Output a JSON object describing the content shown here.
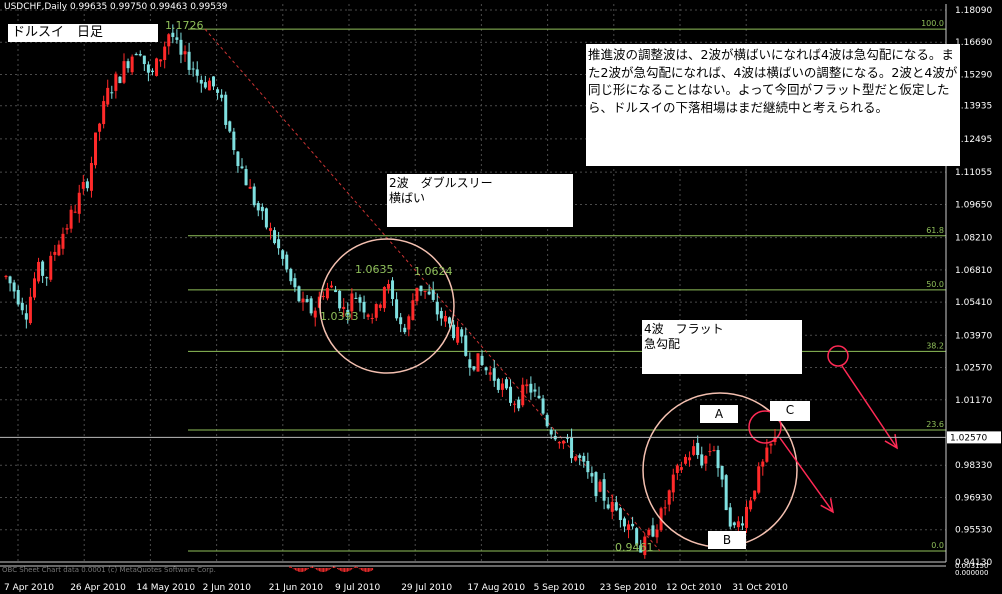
{
  "header": {
    "symbol_info": "USDCHF,Daily  0.99635 0.99750 0.99463 0.99539"
  },
  "title_box": {
    "text": "ドルスイ　日足"
  },
  "annotations": {
    "main_note": "推進波の調整波は、2波が横ばいになれば4波は急勾配になる。また2波が急勾配になれば、4波は横ばいの調整になる。2波と4波が同じ形になることはない。よって今回がフラット型だと仮定したら、ドルスイの下落相場はまだ継続中と考えられる。",
    "wave2_line1": "2波　ダブルスリー",
    "wave2_line2": "横ばい",
    "wave4_line1": "4波　フラット",
    "wave4_line2": "急勾配",
    "label_a": "A",
    "label_b": "B",
    "label_c": "C"
  },
  "price_labels": {
    "high": "1.1726",
    "p1": "1.0635",
    "p2": "1.0624",
    "p3": "1.0393",
    "low": "0.9461"
  },
  "indicator_text": "OBC Sheet Chart data 0.0001 (c) MetaQuotes Software Corp.",
  "colors": {
    "bull": "#ff2a2a",
    "bear": "#7fe0e0",
    "fib": "#8fbf5a",
    "grid": "#4a4a4a",
    "circle": "#f4c0b0",
    "arrow": "#ff2a55",
    "trend": "#cc3333",
    "price_box": "#ffffff"
  },
  "chart_data": {
    "type": "candlestick",
    "symbol": "USDCHF",
    "timeframe": "Daily",
    "current": {
      "open": 0.99635,
      "high": 0.9975,
      "low": 0.99463,
      "close": 0.99539
    },
    "y_axis": {
      "ylim": [
        0.9413,
        1.1835
      ],
      "ticks": [
        "1.18090",
        "1.16690",
        "1.15290",
        "1.13935",
        "1.12495",
        "1.11055",
        "1.09650",
        "1.08210",
        "1.06810",
        "1.05410",
        "1.03970",
        "1.02570",
        "1.01170",
        "0.99535",
        "0.98330",
        "0.96930",
        "0.95530",
        "0.94130"
      ]
    },
    "x_axis": {
      "ticks": [
        "7 Apr 2010",
        "26 Apr 2010",
        "14 May 2010",
        "2 Jun 2010",
        "21 Jun 2010",
        "9 Jul 2010",
        "29 Jul 2010",
        "17 Aug 2010",
        "5 Sep 2010",
        "23 Sep 2010",
        "12 Oct 2010",
        "31 Oct 2010"
      ]
    },
    "fibonacci": [
      {
        "level": "100.0",
        "price": 1.1726
      },
      {
        "level": "61.8",
        "price": 1.0829
      },
      {
        "level": "50.0",
        "price": 1.0594
      },
      {
        "level": "38.2",
        "price": 1.0327
      },
      {
        "level": "23.6",
        "price": 0.9986
      },
      {
        "level": "0.0",
        "price": 0.9461
      }
    ],
    "key_prices": [
      1.1726,
      1.0635,
      1.0624,
      1.0393,
      0.9461
    ],
    "path": [
      [
        1.065,
        1.058
      ],
      [
        1.05,
        1.068
      ],
      [
        1.066,
        1.08
      ],
      [
        1.088,
        1.098
      ],
      [
        1.108,
        1.13
      ],
      [
        1.146,
        1.152
      ],
      [
        1.16,
        1.166
      ],
      [
        1.15,
        1.16
      ],
      [
        1.1726,
        1.16
      ],
      [
        1.158,
        1.15
      ],
      [
        1.15,
        1.14
      ],
      [
        1.125,
        1.112
      ],
      [
        1.1,
        1.09
      ],
      [
        1.083,
        1.072
      ],
      [
        1.06,
        1.052
      ],
      [
        1.05,
        1.06
      ],
      [
        1.06,
        1.05
      ],
      [
        1.058,
        1.052
      ],
      [
        1.048,
        1.0635
      ],
      [
        1.05,
        1.04
      ],
      [
        1.0624,
        1.058
      ],
      [
        1.05,
        1.045
      ],
      [
        1.04,
        1.03
      ],
      [
        1.028,
        1.024
      ],
      [
        1.02,
        1.012
      ],
      [
        1.012,
        1.018
      ],
      [
        1.01,
        1.0
      ],
      [
        0.996,
        0.99
      ],
      [
        0.985,
        0.976
      ],
      [
        0.972,
        0.965
      ],
      [
        0.962,
        0.958
      ],
      [
        0.9461,
        0.955
      ],
      [
        0.962,
        0.975
      ],
      [
        0.985,
        0.99
      ],
      [
        0.985,
        0.993
      ],
      [
        0.97,
        0.955
      ],
      [
        0.962,
        0.975
      ],
      [
        0.985,
        0.99539
      ]
    ]
  }
}
